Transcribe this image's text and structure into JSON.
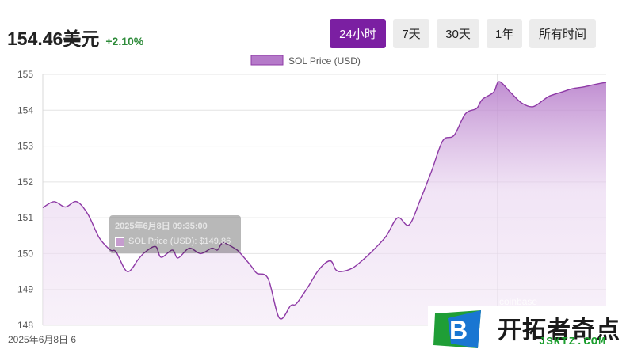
{
  "price": {
    "value": "154.46美元",
    "change": "+2.10%"
  },
  "range_tabs": [
    {
      "label": "24小时",
      "active": true
    },
    {
      "label": "7天",
      "active": false
    },
    {
      "label": "30天",
      "active": false
    },
    {
      "label": "1年",
      "active": false
    },
    {
      "label": "所有时间",
      "active": false
    }
  ],
  "tooltip": {
    "title": "2025年6月8日 09:35:00",
    "row": "SOL Price (USD): $149.86"
  },
  "watermark": {
    "cn": "开拓者奇点",
    "en": "JSKTZ.COM",
    "faint": "coinbase"
  },
  "colors": {
    "accent": "#7b1fa2",
    "line": "#8e3aa6",
    "fill": "#c89ad6",
    "positive": "#2e8b3a"
  },
  "chart_data": {
    "type": "area",
    "legend": [
      "SOL Price (USD)"
    ],
    "legend_position": "top-center",
    "x_tick_labels": [
      "2025年6月8日 6"
    ],
    "grid": true,
    "ylim": [
      148,
      155
    ],
    "y_ticks": [
      148,
      149,
      150,
      151,
      152,
      153,
      154,
      155
    ],
    "series": [
      {
        "name": "SOL Price (USD)",
        "x": [
          0,
          0.02,
          0.04,
          0.06,
          0.08,
          0.1,
          0.12,
          0.13,
          0.15,
          0.17,
          0.18,
          0.2,
          0.21,
          0.23,
          0.24,
          0.26,
          0.28,
          0.3,
          0.31,
          0.32,
          0.34,
          0.35,
          0.37,
          0.38,
          0.4,
          0.42,
          0.44,
          0.45,
          0.47,
          0.49,
          0.51,
          0.52,
          0.53,
          0.55,
          0.57,
          0.59,
          0.61,
          0.63,
          0.65,
          0.67,
          0.69,
          0.71,
          0.73,
          0.75,
          0.77,
          0.78,
          0.8,
          0.81,
          0.83,
          0.85,
          0.87,
          0.89,
          0.9,
          0.92,
          0.94,
          0.96,
          0.98,
          1.0
        ],
        "values": [
          151.28,
          151.45,
          151.3,
          151.45,
          151.1,
          150.45,
          150.1,
          150.05,
          149.5,
          149.85,
          150.02,
          150.2,
          149.9,
          150.1,
          149.88,
          150.15,
          150.0,
          150.15,
          150.1,
          150.3,
          150.15,
          150.02,
          149.65,
          149.45,
          149.3,
          148.2,
          148.55,
          148.6,
          149.05,
          149.55,
          149.8,
          149.55,
          149.5,
          149.6,
          149.85,
          150.15,
          150.5,
          151.0,
          150.8,
          151.5,
          152.3,
          153.15,
          153.3,
          153.9,
          154.05,
          154.3,
          154.5,
          154.8,
          154.5,
          154.2,
          154.1,
          154.3,
          154.4,
          154.5,
          154.6,
          154.65,
          154.72,
          154.78
        ]
      }
    ],
    "highlight_point": {
      "x": 0.13,
      "value": 149.86,
      "time": "2025年6月8日 09:35:00"
    }
  }
}
